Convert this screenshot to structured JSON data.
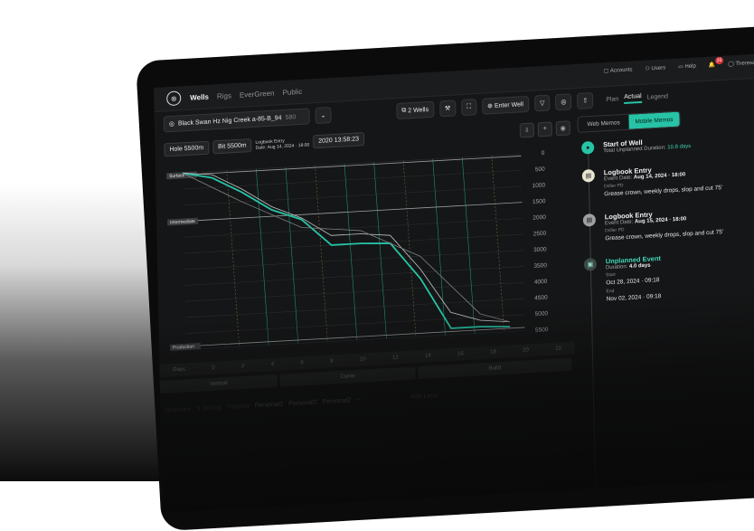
{
  "nav": {
    "wells": "Wells",
    "rigs": "Rigs",
    "evergreen": "EverGreen",
    "public": "Public"
  },
  "top_right": {
    "accounts": "Accounts",
    "users": "Users",
    "help": "Help",
    "notif_count": "26",
    "user": "Theresa Christensen"
  },
  "toolbar": {
    "well_name": "Black Swan Hz Nig Creek a-85-B_94",
    "well_code": "580",
    "wells_btn": "2 Wells",
    "enter_well": "Enter Well",
    "plan": "Plan",
    "actual": "Actual",
    "legend": "Legend"
  },
  "chart_info": {
    "hole": "Hole 5500m",
    "bit": "Bit 5500m",
    "logbook_title": "Logbook Entry",
    "logbook_date": "Date: Aug 14, 2024 · 18:00",
    "timestamp": "2020 13:58:23"
  },
  "chart_data": {
    "type": "line",
    "y_ticks": [
      "0",
      "500",
      "1000",
      "1500",
      "2000",
      "2500",
      "3000",
      "3500",
      "4000",
      "4500",
      "5000",
      "5500"
    ],
    "x_ticks": [
      "Days",
      "0",
      "2",
      "4",
      "6",
      "8",
      "10",
      "12",
      "14",
      "16",
      "18",
      "20",
      "22"
    ],
    "casing_labels": [
      "Surface",
      "Intermediate",
      "Production"
    ],
    "series": [
      {
        "name": "",
        "x": [
          0,
          2,
          4,
          6,
          8,
          10,
          12,
          14,
          16,
          18,
          20,
          22
        ],
        "y": [
          0,
          200,
          700,
          1300,
          1650,
          2500,
          2500,
          2550,
          3700,
          5300,
          5300,
          5350
        ]
      },
      {
        "name": "",
        "x": [
          0,
          2,
          4,
          6,
          8,
          10,
          12,
          14,
          16,
          18,
          20,
          22
        ],
        "y": [
          0,
          100,
          600,
          1200,
          1600,
          2200,
          2200,
          2300,
          3400,
          4800,
          5100,
          5200
        ]
      },
      {
        "name": "",
        "x": [
          0,
          4,
          8,
          12,
          16,
          20,
          22
        ],
        "y": [
          0,
          1000,
          1900,
          2100,
          3000,
          4900,
          5200
        ]
      }
    ],
    "ylim": [
      0,
      5500
    ],
    "grid": true
  },
  "segments": [
    "Vertical",
    "Curve",
    "Build"
  ],
  "bottom_tabs": [
    "Overview",
    "3 Drilling",
    "Tripping",
    "Personal2",
    "Personal2",
    "Personal2",
    "+",
    "Add Lens"
  ],
  "memo_tabs": {
    "web": "Web Memos",
    "mobile": "Mobile Memos"
  },
  "timeline": [
    {
      "title": "Start of Well",
      "sub": "Total Unplanned Duration:",
      "sub_value": "10.8 days"
    },
    {
      "title": "Logbook Entry",
      "date_label": "Event Date:",
      "date": "Aug 14, 2024 · 18:00",
      "label": "Driller PD",
      "text": "Grease crown, weekly drops, slop and cut 75'"
    },
    {
      "title": "Logbook Entry",
      "date_label": "Event Date:",
      "date": "Aug 15, 2024 · 18:00",
      "label": "Driller PD",
      "text": "Grease crown, weekly drops, slop and cut 75'"
    },
    {
      "title": "Unplanned Event",
      "duration_label": "Duration:",
      "duration": "4.0 days",
      "start_label": "Start",
      "start": "Oct 28, 2024 · 09:18",
      "end_label": "End",
      "end": "Nov 02, 2024 · 09:18"
    }
  ]
}
